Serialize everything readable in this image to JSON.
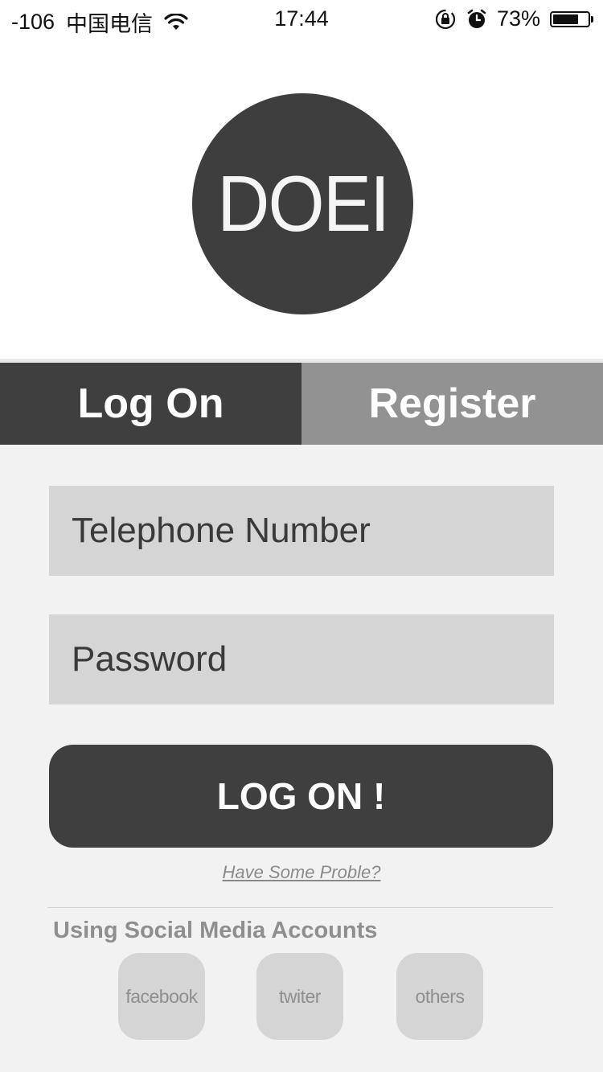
{
  "status_bar": {
    "signal": "-106",
    "carrier": "中国电信",
    "time": "17:44",
    "battery_percent": "73%",
    "battery_level": 0.73,
    "icons": [
      "wifi-icon",
      "lock-rotation-icon",
      "alarm-icon",
      "battery-icon"
    ]
  },
  "brand": {
    "logo_text": "DOEI",
    "color": "#3e3e3e"
  },
  "tabs": [
    {
      "label": "Log On",
      "active": true
    },
    {
      "label": "Register",
      "active": false
    }
  ],
  "form": {
    "phone_placeholder": "Telephone Number",
    "phone_value": "",
    "password_placeholder": "Password",
    "password_value": "",
    "submit_label": "LOG ON !",
    "help_link": "Have Some Proble?"
  },
  "social": {
    "heading": "Using Social Media Accounts",
    "buttons": [
      {
        "label": "facebook"
      },
      {
        "label": "twiter"
      },
      {
        "label": "others"
      }
    ]
  },
  "colors": {
    "dark": "#3f3f3f",
    "inactive_tab": "#929292",
    "field_bg": "#d5d5d5",
    "page_bg": "#f2f2f2"
  }
}
